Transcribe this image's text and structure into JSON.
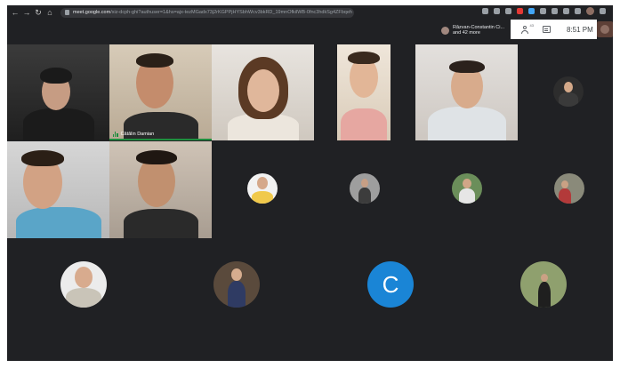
{
  "browser": {
    "nav_icons": [
      "back-icon",
      "forward-icon",
      "reload-icon",
      "home-icon"
    ],
    "url_host": "meet.google.com",
    "url_path": "/xiz-dcph-ghi?authuser=1&hs=ajx-tezMGadx73j2rKGPPjHYSbhWcv3bkRD_19mnOfkilWB-0fnc3hdkSg4ZFbqeh"
  },
  "meet": {
    "presenter": {
      "line1": "Răzvan-Constantin Ci...",
      "line2": "and 42 more"
    },
    "participants_count": "43",
    "time": "8:51 PM",
    "tiles": [
      {
        "id": "tile-1",
        "name": ""
      },
      {
        "id": "tile-2",
        "name": "Cătălin Damian"
      },
      {
        "id": "tile-3",
        "name": ""
      },
      {
        "id": "tile-4",
        "name": ""
      },
      {
        "id": "tile-5",
        "name": ""
      },
      {
        "id": "tile-6",
        "name": ""
      },
      {
        "id": "tile-7",
        "name": ""
      }
    ],
    "letter_avatar": "C"
  },
  "colors": {
    "meet_bg": "#202124",
    "active_speaker": "#1e8e3e",
    "letter_avatar_bg": "#1a85d6"
  }
}
